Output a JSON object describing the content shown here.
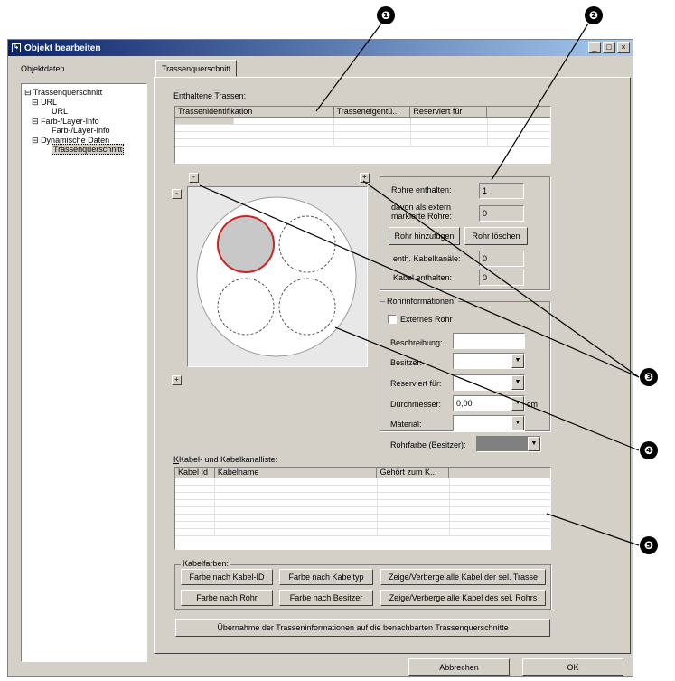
{
  "callouts": [
    "❶",
    "❷",
    "❸",
    "❹",
    "❺"
  ],
  "window": {
    "title": "Objekt bearbeiten",
    "minimize": "_",
    "maximize": "□",
    "close": "×"
  },
  "left_label": "Objektdaten",
  "tree": [
    {
      "label": "Trassenquerschnitt",
      "toggle": "⊟"
    },
    {
      "label": "URL",
      "toggle": "⊟"
    },
    {
      "label": "URL",
      "toggle": ""
    },
    {
      "label": "Farb-/Layer-Info",
      "toggle": "⊟"
    },
    {
      "label": "Farb-/Layer-Info",
      "toggle": ""
    },
    {
      "label": "Dynamische Daten",
      "toggle": "⊟"
    },
    {
      "label": "Trassenquerschnitt",
      "toggle": ""
    }
  ],
  "tab": "Trassenquerschnitt",
  "trassen": {
    "label": "Enthaltene Trassen:",
    "columns": [
      "Trassenidentifikation",
      "Trasseneigentü...",
      "Reserviert für",
      ""
    ]
  },
  "rohre": {
    "rohre_enthalten_label": "Rohre enthalten:",
    "rohre_enthalten_value": "1",
    "extern_label": "davon als extern markierte Rohre:",
    "extern_value": "0",
    "add_btn": "Rohr hinzufügen",
    "del_btn": "Rohr löschen",
    "kanaele_label": "enth. Kabelkanäle:",
    "kanaele_value": "0",
    "kabel_label": "Kabel enthalten:",
    "kabel_value": "0"
  },
  "rohrinfo": {
    "group": "Rohrinformationen:",
    "extern_chk": "Externes Rohr",
    "beschreibung": "Beschreibung:",
    "besitzer": "Besitzer:",
    "reserviert": "Reserviert für:",
    "durchmesser": "Durchmesser:",
    "durchmesser_value": "0,00",
    "unit": "cm",
    "material": "Material:",
    "rohrfarbe": "Rohrfarbe (Besitzer):"
  },
  "plus_minus": {
    "minus": "-",
    "plus": "+"
  },
  "kabel": {
    "label": "Kabel- und Kabelkanalliste:",
    "columns": [
      "Kabel Id",
      "Kabelname",
      "Gehört zum K...",
      ""
    ]
  },
  "kabelfarben": {
    "group": "Kabelfarben:",
    "b1": "Farbe nach Kabel-ID",
    "b2": "Farbe nach Kabeltyp",
    "b3": "Farbe nach Rohr",
    "b4": "Farbe nach Besitzer",
    "b5": "Zeige/Verberge alle Kabel der sel. Trasse",
    "b6": "Zeige/Verberge alle Kabel des sel. Rohrs"
  },
  "uebernahme": "Übernahme der Trasseninformationen auf die benachbarten Trassenquerschnitte",
  "footer": {
    "cancel": "Abbrechen",
    "ok": "OK"
  },
  "colors": {
    "selected_pipe": "#c8c8c8",
    "selected_border": "#cc2222",
    "title_start": "#0a246a"
  }
}
